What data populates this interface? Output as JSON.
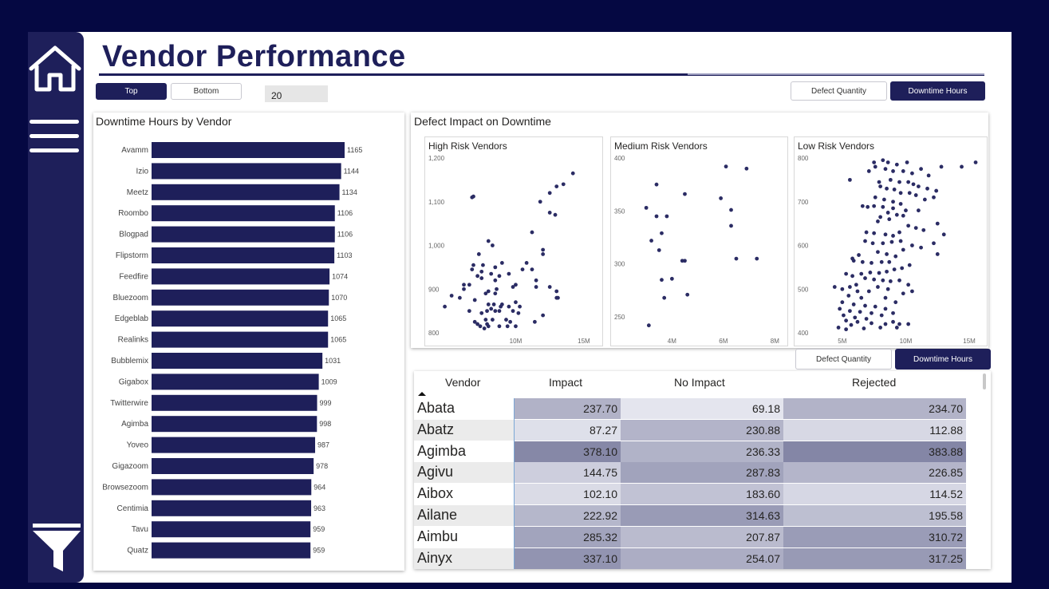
{
  "page": {
    "title": "Vendor Performance"
  },
  "colors": {
    "navy": "#1e1f5a",
    "background": "#050842",
    "dot": "#2b2c64"
  },
  "nav": {
    "home_icon": "home-icon",
    "menu_icon": "hamburger-menu-icon",
    "filter_icon": "funnel-filter-icon"
  },
  "topn": {
    "top_label": "Top",
    "bottom_label": "Bottom",
    "count": "20",
    "selected": "Top"
  },
  "metric_toggle": {
    "defect_label": "Defect Quantity",
    "downtime_label": "Downtime Hours",
    "selected": "Downtime Hours"
  },
  "metric_toggle2": {
    "defect_label": "Defect Quantity",
    "downtime_label": "Downtime Hours",
    "selected": "Downtime Hours"
  },
  "bar_chart": {
    "title": "Downtime Hours by Vendor"
  },
  "scatter_card": {
    "title": "Defect Impact on Downtime"
  },
  "chart_data": [
    {
      "type": "bar",
      "orientation": "horizontal",
      "title": "Downtime Hours by Vendor",
      "categories": [
        "Avamm",
        "Izio",
        "Meetz",
        "Roombo",
        "Blogpad",
        "Flipstorm",
        "Feedfire",
        "Bluezoom",
        "Edgeblab",
        "Realinks",
        "Bubblemix",
        "Gigabox",
        "Twitterwire",
        "Agimba",
        "Yoveo",
        "Gigazoom",
        "Browsezoom",
        "Centimia",
        "Tavu",
        "Quatz"
      ],
      "values": [
        1165,
        1144,
        1134,
        1106,
        1106,
        1103,
        1074,
        1070,
        1065,
        1065,
        1031,
        1009,
        999,
        998,
        987,
        978,
        964,
        963,
        959,
        959
      ],
      "xlim": [
        0,
        1165
      ],
      "data_labels": true,
      "color": "#1e1f5a"
    },
    {
      "type": "scatter",
      "title": "High Risk Vendors",
      "xlim": [
        5,
        16
      ],
      "ylim": [
        800,
        1200
      ],
      "x_ticks": [
        "10M",
        "15M"
      ],
      "y_ticks": [
        "800",
        "900",
        "1,000",
        "1,100",
        "1,200"
      ],
      "points": [
        [
          14.2,
          1165
        ],
        [
          13.5,
          1140
        ],
        [
          12.5,
          1120
        ],
        [
          13.0,
          1135
        ],
        [
          11.8,
          1100
        ],
        [
          12.9,
          1070
        ],
        [
          12.5,
          1075
        ],
        [
          6.8,
          1110
        ],
        [
          6.9,
          1112
        ],
        [
          8.0,
          1010
        ],
        [
          8.3,
          1000
        ],
        [
          7.3,
          980
        ],
        [
          11.2,
          1030
        ],
        [
          12.0,
          990
        ],
        [
          12.0,
          980
        ],
        [
          10.8,
          960
        ],
        [
          10.5,
          945
        ],
        [
          11.2,
          945
        ],
        [
          11.5,
          920
        ],
        [
          9.0,
          960
        ],
        [
          8.5,
          950
        ],
        [
          7.6,
          955
        ],
        [
          6.9,
          955
        ],
        [
          6.8,
          945
        ],
        [
          7.5,
          940
        ],
        [
          8.2,
          935
        ],
        [
          8.8,
          930
        ],
        [
          8.5,
          920
        ],
        [
          7.2,
          930
        ],
        [
          7.5,
          925
        ],
        [
          9.5,
          935
        ],
        [
          10.0,
          910
        ],
        [
          9.8,
          905
        ],
        [
          11.5,
          905
        ],
        [
          12.5,
          905
        ],
        [
          13.0,
          895
        ],
        [
          13.1,
          880
        ],
        [
          8.6,
          900
        ],
        [
          8.0,
          895
        ],
        [
          8.5,
          890
        ],
        [
          7.8,
          890
        ],
        [
          6.2,
          910
        ],
        [
          6.6,
          910
        ],
        [
          6.2,
          900
        ],
        [
          5.3,
          885
        ],
        [
          5.9,
          880
        ],
        [
          7.0,
          875
        ],
        [
          8.0,
          865
        ],
        [
          9.0,
          865
        ],
        [
          8.4,
          865
        ],
        [
          8.9,
          860
        ],
        [
          9.5,
          860
        ],
        [
          10.0,
          870
        ],
        [
          10.3,
          860
        ],
        [
          9.8,
          850
        ],
        [
          10.2,
          845
        ],
        [
          8.8,
          850
        ],
        [
          8.5,
          850
        ],
        [
          8.2,
          855
        ],
        [
          7.9,
          850
        ],
        [
          7.5,
          845
        ],
        [
          7.8,
          830
        ],
        [
          8.3,
          830
        ],
        [
          7.9,
          820
        ],
        [
          8.0,
          815
        ],
        [
          7.7,
          810
        ],
        [
          7.4,
          815
        ],
        [
          7.2,
          820
        ],
        [
          7.0,
          825
        ],
        [
          9.3,
          830
        ],
        [
          9.6,
          825
        ],
        [
          10.0,
          815
        ],
        [
          9.4,
          815
        ],
        [
          8.8,
          815
        ],
        [
          11.4,
          825
        ],
        [
          12.0,
          840
        ],
        [
          13.0,
          880
        ],
        [
          4.8,
          860
        ],
        [
          6.6,
          850
        ]
      ]
    },
    {
      "type": "scatter",
      "title": "Medium Risk Vendors",
      "xlim": [
        2.5,
        8.3
      ],
      "ylim": [
        235,
        400
      ],
      "x_ticks": [
        "4M",
        "6M",
        "8M"
      ],
      "y_ticks": [
        "250",
        "300",
        "350",
        "400"
      ],
      "points": [
        [
          3.4,
          375
        ],
        [
          4.5,
          366
        ],
        [
          6.1,
          392
        ],
        [
          6.9,
          390
        ],
        [
          5.9,
          362
        ],
        [
          3.0,
          353
        ],
        [
          3.8,
          345
        ],
        [
          6.3,
          351
        ],
        [
          3.4,
          345
        ],
        [
          6.3,
          336
        ],
        [
          3.6,
          329
        ],
        [
          3.2,
          322
        ],
        [
          3.5,
          313
        ],
        [
          4.4,
          303
        ],
        [
          4.5,
          303
        ],
        [
          6.5,
          305
        ],
        [
          7.3,
          305
        ],
        [
          3.6,
          285
        ],
        [
          4.0,
          286
        ],
        [
          4.6,
          271
        ],
        [
          3.7,
          268
        ],
        [
          3.1,
          242
        ]
      ]
    },
    {
      "type": "scatter",
      "title": "Low Risk Vendors",
      "xlim": [
        3,
        16
      ],
      "ylim": [
        400,
        800
      ],
      "x_ticks": [
        "5M",
        "10M",
        "15M"
      ],
      "y_ticks": [
        "400",
        "500",
        "600",
        "700",
        "800"
      ],
      "points": [
        [
          7.5,
          790
        ],
        [
          8.2,
          795
        ],
        [
          8.6,
          790
        ],
        [
          9.3,
          785
        ],
        [
          10.1,
          790
        ],
        [
          7.6,
          780
        ],
        [
          8.4,
          775
        ],
        [
          9.0,
          770
        ],
        [
          9.8,
          770
        ],
        [
          10.5,
          765
        ],
        [
          11.2,
          775
        ],
        [
          11.8,
          760
        ],
        [
          12.8,
          780
        ],
        [
          14.4,
          780
        ],
        [
          15.5,
          790
        ],
        [
          5.6,
          750
        ],
        [
          7.1,
          770
        ],
        [
          7.9,
          745
        ],
        [
          8.8,
          750
        ],
        [
          9.5,
          745
        ],
        [
          10.2,
          745
        ],
        [
          10.6,
          740
        ],
        [
          11.0,
          735
        ],
        [
          11.7,
          730
        ],
        [
          12.4,
          725
        ],
        [
          8.0,
          735
        ],
        [
          8.5,
          730
        ],
        [
          9.1,
          728
        ],
        [
          9.6,
          720
        ],
        [
          10.3,
          720
        ],
        [
          10.8,
          715
        ],
        [
          11.5,
          705
        ],
        [
          7.6,
          710
        ],
        [
          8.3,
          705
        ],
        [
          9.0,
          700
        ],
        [
          9.6,
          695
        ],
        [
          12.2,
          710
        ],
        [
          6.6,
          690
        ],
        [
          7.0,
          688
        ],
        [
          7.5,
          690
        ],
        [
          8.2,
          688
        ],
        [
          9.0,
          685
        ],
        [
          10.0,
          680
        ],
        [
          11.0,
          680
        ],
        [
          8.6,
          675
        ],
        [
          9.3,
          670
        ],
        [
          9.8,
          668
        ],
        [
          8.0,
          665
        ],
        [
          8.7,
          660
        ],
        [
          7.8,
          655
        ],
        [
          12.5,
          650
        ],
        [
          10.2,
          645
        ],
        [
          10.8,
          640
        ],
        [
          11.4,
          635
        ],
        [
          13.0,
          625
        ],
        [
          12.2,
          605
        ],
        [
          9.5,
          630
        ],
        [
          9.0,
          622
        ],
        [
          8.4,
          625
        ],
        [
          7.5,
          628
        ],
        [
          6.9,
          630
        ],
        [
          9.6,
          610
        ],
        [
          8.9,
          608
        ],
        [
          8.2,
          605
        ],
        [
          7.4,
          605
        ],
        [
          6.8,
          610
        ],
        [
          10.5,
          600
        ],
        [
          11.2,
          595
        ],
        [
          12.5,
          580
        ],
        [
          9.8,
          590
        ],
        [
          8.5,
          580
        ],
        [
          7.8,
          585
        ],
        [
          6.3,
          578
        ],
        [
          5.8,
          570
        ],
        [
          9.2,
          575
        ],
        [
          8.7,
          562
        ],
        [
          8.1,
          562
        ],
        [
          7.3,
          560
        ],
        [
          6.6,
          562
        ],
        [
          5.9,
          565
        ],
        [
          10.3,
          555
        ],
        [
          9.7,
          548
        ],
        [
          9.1,
          545
        ],
        [
          8.5,
          540
        ],
        [
          7.9,
          537
        ],
        [
          7.2,
          538
        ],
        [
          6.5,
          535
        ],
        [
          5.8,
          530
        ],
        [
          5.3,
          535
        ],
        [
          6.8,
          525
        ],
        [
          7.5,
          522
        ],
        [
          8.2,
          520
        ],
        [
          8.8,
          518
        ],
        [
          9.5,
          520
        ],
        [
          10.2,
          510
        ],
        [
          6.1,
          510
        ],
        [
          5.6,
          505
        ],
        [
          5.0,
          500
        ],
        [
          4.4,
          505
        ],
        [
          7.8,
          505
        ],
        [
          8.6,
          500
        ],
        [
          6.2,
          495
        ],
        [
          7.1,
          495
        ],
        [
          9.8,
          490
        ],
        [
          10.5,
          495
        ],
        [
          5.5,
          485
        ],
        [
          6.5,
          480
        ],
        [
          8.4,
          480
        ],
        [
          9.2,
          470
        ],
        [
          5.0,
          470
        ],
        [
          5.9,
          465
        ],
        [
          6.8,
          462
        ],
        [
          7.6,
          460
        ],
        [
          8.4,
          455
        ],
        [
          4.8,
          455
        ],
        [
          5.6,
          450
        ],
        [
          6.4,
          448
        ],
        [
          7.3,
          445
        ],
        [
          8.1,
          440
        ],
        [
          9.0,
          445
        ],
        [
          5.1,
          440
        ],
        [
          6.0,
          435
        ],
        [
          6.9,
          432
        ],
        [
          5.3,
          428
        ],
        [
          6.2,
          425
        ],
        [
          7.3,
          422
        ],
        [
          8.4,
          420
        ],
        [
          9.5,
          420
        ],
        [
          10.2,
          420
        ],
        [
          9.0,
          425
        ],
        [
          5.7,
          418
        ],
        [
          4.7,
          412
        ],
        [
          5.3,
          408
        ],
        [
          6.7,
          410
        ],
        [
          8.0,
          412
        ],
        [
          9.3,
          412
        ]
      ]
    },
    {
      "type": "table",
      "columns": [
        "Vendor",
        "Impact",
        "No Impact",
        "Rejected"
      ],
      "sort": {
        "column": "Vendor",
        "direction": "ascending"
      },
      "rows": [
        [
          "Abata",
          "237.70",
          "69.18",
          "234.70"
        ],
        [
          "Abatz",
          "87.27",
          "230.88",
          "112.88"
        ],
        [
          "Agimba",
          "378.10",
          "236.33",
          "383.88"
        ],
        [
          "Agivu",
          "144.75",
          "287.83",
          "226.85"
        ],
        [
          "Aibox",
          "102.10",
          "183.60",
          "114.52"
        ],
        [
          "Ailane",
          "222.92",
          "314.63",
          "195.58"
        ],
        [
          "Aimbu",
          "285.32",
          "207.87",
          "310.72"
        ],
        [
          "Ainyx",
          "337.10",
          "254.07",
          "317.25"
        ]
      ]
    }
  ]
}
